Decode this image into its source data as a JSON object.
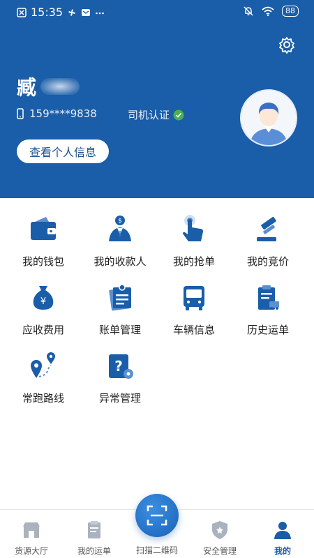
{
  "status_bar": {
    "time": "15:35",
    "icons": [
      "close-box-icon",
      "fan-icon",
      "mail-icon",
      "more-dots-icon"
    ],
    "battery": "88"
  },
  "profile": {
    "name": "臧",
    "phone": "159****9838",
    "cert_label": "司机认证",
    "view_info_button": "查看个人信息"
  },
  "menu": [
    {
      "label": "我的钱包",
      "icon": "wallet-icon"
    },
    {
      "label": "我的收款人",
      "icon": "payee-icon"
    },
    {
      "label": "我的抢单",
      "icon": "tap-grab-order-icon"
    },
    {
      "label": "我的竞价",
      "icon": "auction-gavel-icon"
    },
    {
      "label": "应收费用",
      "icon": "money-bag-icon"
    },
    {
      "label": "账单管理",
      "icon": "bill-icon"
    },
    {
      "label": "车辆信息",
      "icon": "bus-icon"
    },
    {
      "label": "历史运单",
      "icon": "history-waybill-icon"
    },
    {
      "label": "常跑路线",
      "icon": "route-icon"
    },
    {
      "label": "异常管理",
      "icon": "exception-icon"
    }
  ],
  "tabs": [
    {
      "label": "货源大厅",
      "icon": "store-icon"
    },
    {
      "label": "我的运单",
      "icon": "waybill-icon"
    },
    {
      "label": "扫描二维码",
      "icon": "scan-icon"
    },
    {
      "label": "安全管理",
      "icon": "shield-icon"
    },
    {
      "label": "我的",
      "icon": "person-icon"
    }
  ],
  "colors": {
    "brand": "#1a5da8",
    "active_tab": "#1a5da8",
    "verified": "#4caf50"
  }
}
